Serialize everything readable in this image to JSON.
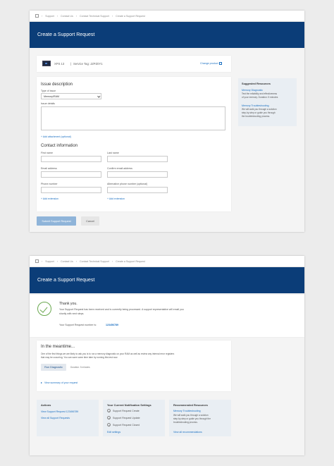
{
  "breadcrumbs": [
    "Support",
    "Contact Us",
    "Contact Technical Support",
    "Create a Support Request"
  ],
  "page_title": "Create a Support Request",
  "device": {
    "name": "XPS 13",
    "service_tag_label": "Service Tag: JZPZ0Y1",
    "change_link": "Change product"
  },
  "issue": {
    "heading": "Issue description",
    "type_label": "Type of issue",
    "type_value": "Memory/RAM",
    "details_label": "Issue details",
    "add_attachment": "+ Add attachment (optional)"
  },
  "contact": {
    "heading": "Contact information",
    "first_name_label": "First name",
    "last_name_label": "Last name",
    "email_label": "Email address",
    "confirm_email_label": "Confirm email address",
    "phone_label": "Phone number",
    "alt_phone_label": "Alternative phone number (optional)",
    "add_extension": "+ Add extension",
    "add_extension_alt": "+ Add extension"
  },
  "suggested": {
    "heading": "Suggested Resources",
    "item1_title": "Memory Diagnostic",
    "item1_desc1": "Test the reliability and effectiveness",
    "item1_desc2": "of your memory. Duration: 5 minutes",
    "item2_title": "Memory Troubleshooting",
    "item2_desc1": "We will walk you through a solution",
    "item2_desc2": "step-by-step or guide you through",
    "item2_desc3": "the troubleshooting process."
  },
  "buttons": {
    "submit": "Submit Support Request",
    "cancel": "Cancel"
  },
  "confirmation": {
    "thank_you": "Thank you.",
    "message1": "Your Support Request has been received and is currently being processed. A support representative will email you",
    "message2": "shortly with next steps.",
    "request_number_label": "Your Support Request number is:",
    "request_number": "123456789"
  },
  "meantime": {
    "heading": "In the meantime...",
    "text1": "One of the first things we are likely to ask you is to run a memory diagnostic on your RAM as well as review any internal error registers",
    "text2": "that may be occurring. You can save some time later by running this test now.",
    "run_button": "Run Diagnostic",
    "duration": "Duration: 5 minutes",
    "view_summary": "View summary of your request"
  },
  "actions": {
    "heading": "Actions",
    "link1": "View Support Request 123456789",
    "link2": "View all Support Requests"
  },
  "notifications": {
    "heading": "Your Current Notification Settings",
    "item1": "Support Request Create",
    "item2": "Support Request Update",
    "item3": "Support Request Closed",
    "edit": "Edit settings"
  },
  "recommended": {
    "heading": "Recommended Resources",
    "title": "Memory Troubleshooting",
    "desc1": "We will walk you through a solution",
    "desc2": "step-by-step or guide you through the",
    "desc3": "troubleshooting process.",
    "view_all": "View all recommendations"
  }
}
